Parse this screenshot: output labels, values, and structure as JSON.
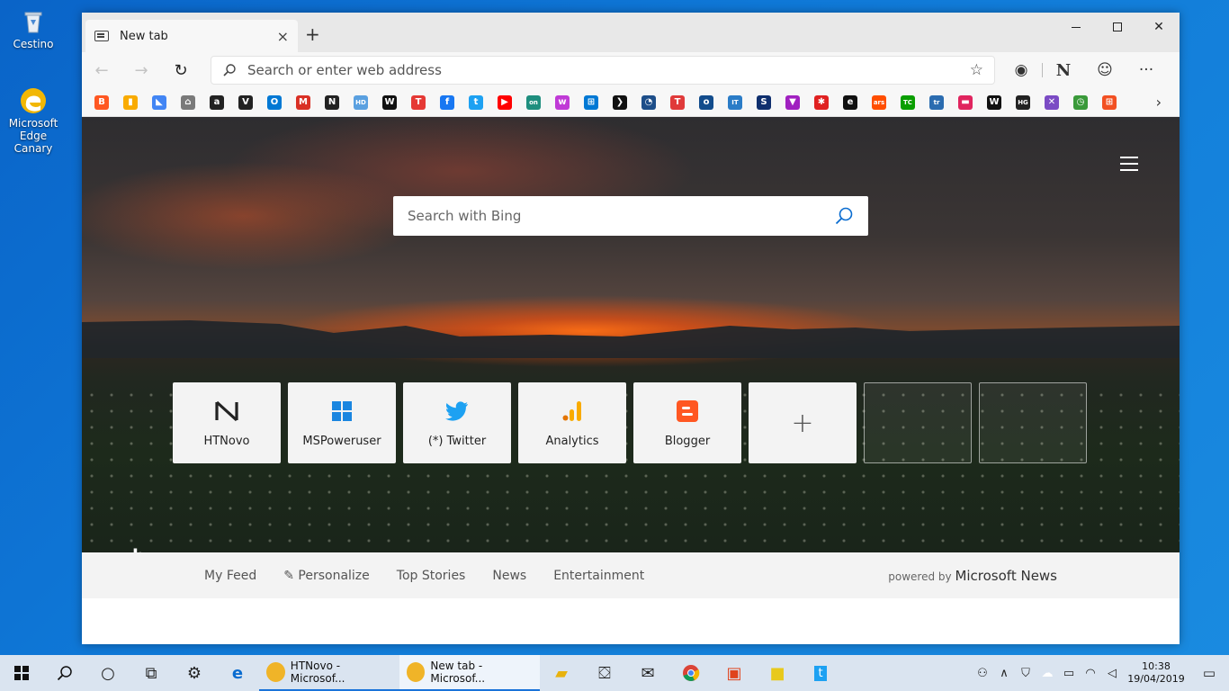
{
  "desktop": {
    "recycle_bin_label": "Cestino",
    "edge_canary_label": "Microsoft Edge Canary"
  },
  "browser": {
    "tab_title": "New tab",
    "tab_close": "×",
    "new_tab": "+",
    "address_placeholder": "Search or enter web address",
    "profile_initial": "N",
    "favorites_more": "›",
    "favorites": [
      {
        "icon": "blogger-icon",
        "glyph": "B",
        "color": "#ff5722"
      },
      {
        "icon": "analytics-icon",
        "glyph": "▮",
        "color": "#f9ab00"
      },
      {
        "icon": "google-ads-icon",
        "glyph": "◣",
        "color": "#4285f4"
      },
      {
        "icon": "store-icon",
        "glyph": "⌂",
        "color": "#7a7a7a"
      },
      {
        "icon": "amazon-icon",
        "glyph": "a",
        "color": "#222222"
      },
      {
        "icon": "verge-icon",
        "glyph": "V",
        "color": "#222222"
      },
      {
        "icon": "outlook-icon",
        "glyph": "O",
        "color": "#0078d4"
      },
      {
        "icon": "gmail-icon",
        "glyph": "M",
        "color": "#d93025"
      },
      {
        "icon": "htnovo-icon",
        "glyph": "N",
        "color": "#222222"
      },
      {
        "icon": "hd-icon",
        "glyph": "HD",
        "color": "#5aa0e0"
      },
      {
        "icon": "windows-central-icon",
        "glyph": "W",
        "color": "#111111"
      },
      {
        "icon": "tnw-icon",
        "glyph": "T",
        "color": "#e53935"
      },
      {
        "icon": "facebook-icon",
        "glyph": "f",
        "color": "#1877f2"
      },
      {
        "icon": "twitter-icon",
        "glyph": "t",
        "color": "#1da1f2"
      },
      {
        "icon": "youtube-icon",
        "glyph": "▶",
        "color": "#ff0000"
      },
      {
        "icon": "on-icon",
        "glyph": "on",
        "color": "#1e8e7e"
      },
      {
        "icon": "w-icon",
        "glyph": "w",
        "color": "#c03ad6"
      },
      {
        "icon": "windows-icon",
        "glyph": "⊞",
        "color": "#0078d4"
      },
      {
        "icon": "arrow-icon",
        "glyph": "❯",
        "color": "#111111"
      },
      {
        "icon": "circle-icon",
        "glyph": "◔",
        "color": "#1d4e89"
      },
      {
        "icon": "t-color-icon",
        "glyph": "T",
        "color": "#e03a3a"
      },
      {
        "icon": "o-icon",
        "glyph": "o",
        "color": "#124c8c"
      },
      {
        "icon": "itpro-icon",
        "glyph": "IT",
        "color": "#2a7cc7"
      },
      {
        "icon": "s-icon",
        "glyph": "S",
        "color": "#0f2f6e"
      },
      {
        "icon": "v-triangle-icon",
        "glyph": "▼",
        "color": "#a020c0"
      },
      {
        "icon": "red-badge-icon",
        "glyph": "✱",
        "color": "#e02020"
      },
      {
        "icon": "e-icon",
        "glyph": "e",
        "color": "#111111"
      },
      {
        "icon": "ars-icon",
        "glyph": "ars",
        "color": "#ff4e00"
      },
      {
        "icon": "techcrunch-icon",
        "glyph": "TC",
        "color": "#0a9e01"
      },
      {
        "icon": "tr-icon",
        "glyph": "tr",
        "color": "#2b6cb0"
      },
      {
        "icon": "pink-icon",
        "glyph": "▬",
        "color": "#e0245e"
      },
      {
        "icon": "w-serif-icon",
        "glyph": "W",
        "color": "#111111"
      },
      {
        "icon": "htg-icon",
        "glyph": "HG",
        "color": "#222222"
      },
      {
        "icon": "x-color-icon",
        "glyph": "✕",
        "color": "#7b4bc4"
      },
      {
        "icon": "clock-icon",
        "glyph": "◷",
        "color": "#3a9a3a"
      },
      {
        "icon": "microsoft-icon",
        "glyph": "⊞",
        "color": "#f25022"
      }
    ]
  },
  "ntp": {
    "search_placeholder": "Search with Bing",
    "tiles": [
      {
        "label": "HTNovo",
        "icon": "htnovo-icon"
      },
      {
        "label": "MSPoweruser",
        "icon": "windows-icon"
      },
      {
        "label": "(*) Twitter",
        "icon": "twitter-icon"
      },
      {
        "label": "Analytics",
        "icon": "analytics-icon"
      },
      {
        "label": "Blogger",
        "icon": "blogger-icon"
      }
    ],
    "add_tile": "+",
    "bing_logo": "b",
    "news_tabs": [
      "My Feed",
      "Personalize",
      "Top Stories",
      "News",
      "Entertainment"
    ],
    "powered_prefix": "powered by",
    "powered_brand": "Microsoft News"
  },
  "taskbar": {
    "apps": [
      {
        "label": "HTNovo - Microsof...",
        "active": false
      },
      {
        "label": "New tab - Microsof...",
        "active": true
      }
    ],
    "time": "10:38",
    "date": "19/04/2019"
  }
}
